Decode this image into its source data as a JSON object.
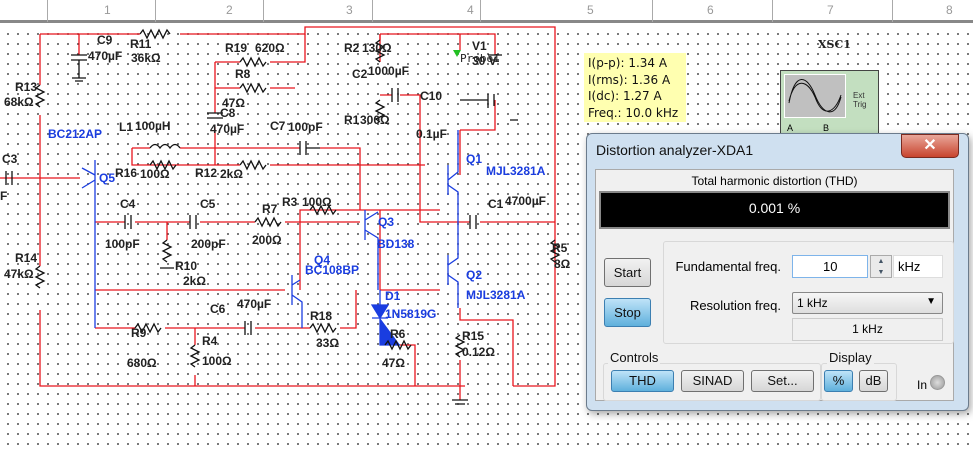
{
  "ruler": [
    "1",
    "2",
    "3",
    "4",
    "5",
    "6",
    "7",
    "8"
  ],
  "components": {
    "C9": "C9",
    "C9v": "470µF",
    "R11": "R11",
    "R11v": "36kΩ",
    "R19": "R19",
    "R19v": "620Ω",
    "R8": "R8",
    "R8v": "47Ω",
    "C8": "C8",
    "C8v": "470µF",
    "R2": "R2",
    "R2v": "130Ω",
    "C2": "C2",
    "C2v": "1000µF",
    "R1": "R1",
    "R1v": "300Ω",
    "C10": "C10",
    "C10v": "0.1µF",
    "V1": "V1",
    "V1v": "30 V",
    "Probe": "Probe1",
    "R13": "R13",
    "R13v": "68kΩ",
    "Q5m": "BC212AP",
    "L1": "L1",
    "L1v": "100µH",
    "C7": "C7",
    "C7v": "100pF",
    "C3": "C3",
    "C3v": "F",
    "R16": "R16",
    "R16v": "100Ω",
    "R12": "R12",
    "R12v": "2kΩ",
    "Q5": "Q5",
    "R3": "R3",
    "R3v": "100Ω",
    "Q1": "Q1",
    "Q1m": "MJL3281A",
    "C1": "C1",
    "C1v": "4700µF",
    "C4": "C4",
    "C4v": "100pF",
    "C5": "C5",
    "C5v": "200pF",
    "R7": "R7",
    "R7v": "200Ω",
    "R10": "R10",
    "R10v": "2kΩ",
    "Q3": "Q3",
    "Q3m": "BD138",
    "R14": "R14",
    "R14v": "47kΩ",
    "Q4": "Q4",
    "Q4m": "BC108BP",
    "R5": "R5",
    "R5v": "8Ω",
    "Q2": "Q2",
    "Q2m": "MJL3281A",
    "D1": "D1",
    "D1m": "1N5819G",
    "C6": "C6",
    "C6v": "470µF",
    "R18": "R18",
    "R18v": "33Ω",
    "R9": "R9",
    "R9v": "680Ω",
    "R4": "R4",
    "R4v": "100Ω",
    "R6": "R6",
    "R6v": "47Ω",
    "R15": "R15",
    "R15v": "0.12Ω"
  },
  "probe": {
    "ipp": "I(p-p): 1.34 A",
    "irms": "I(rms): 1.36 A",
    "idc": "I(dc): 1.27 A",
    "freq": "Freq.: 10.0 kHz"
  },
  "scope": {
    "name": "XSC1",
    "ext": "Ext Trig",
    "a": "A",
    "b": "B"
  },
  "dialog": {
    "title": "Distortion analyzer-XDA1",
    "heading": "Total harmonic distortion (THD)",
    "value": "0.001 %",
    "start": "Start",
    "stop": "Stop",
    "fund_label": "Fundamental freq.",
    "fund_value": "10",
    "fund_unit": "kHz",
    "res_label": "Resolution freq.",
    "res_value": "1 kHz",
    "res_readout": "1 kHz",
    "controls_label": "Controls",
    "thd": "THD",
    "sinad": "SINAD",
    "set": "Set...",
    "display_label": "Display",
    "pct": "%",
    "db": "dB",
    "in": "In"
  },
  "colors": {
    "wire": "#e8141c",
    "transistor": "#1a3de0",
    "display_bg": "#000000",
    "probe_bg": "#ffffb0"
  }
}
